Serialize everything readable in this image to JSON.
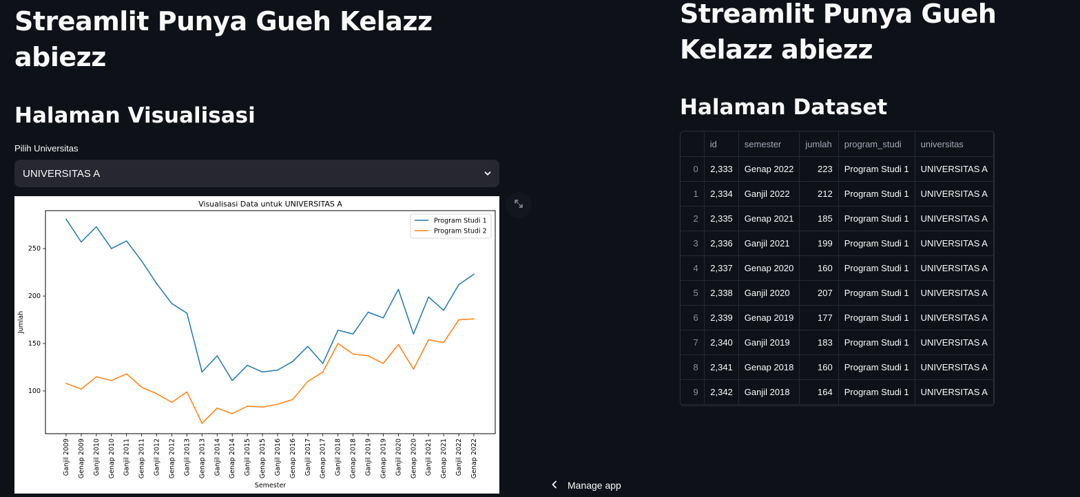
{
  "left": {
    "title": "Streamlit Punya Gueh Kelazz abiezz",
    "subtitle": "Halaman Visualisasi",
    "select_label": "Pilih Universitas",
    "select_value": "UNIVERSITAS A"
  },
  "right": {
    "title": "Streamlit Punya Gueh Kelazz abiezz",
    "subtitle": "Halaman Dataset"
  },
  "table": {
    "columns": [
      "",
      "id",
      "semester",
      "jumlah",
      "program_studi",
      "universitas"
    ],
    "rows": [
      [
        "0",
        "2,333",
        "Genap 2022",
        "223",
        "Program Studi 1",
        "UNIVERSITAS A"
      ],
      [
        "1",
        "2,334",
        "Ganjil 2022",
        "212",
        "Program Studi 1",
        "UNIVERSITAS A"
      ],
      [
        "2",
        "2,335",
        "Genap 2021",
        "185",
        "Program Studi 1",
        "UNIVERSITAS A"
      ],
      [
        "3",
        "2,336",
        "Ganjil 2021",
        "199",
        "Program Studi 1",
        "UNIVERSITAS A"
      ],
      [
        "4",
        "2,337",
        "Genap 2020",
        "160",
        "Program Studi 1",
        "UNIVERSITAS A"
      ],
      [
        "5",
        "2,338",
        "Ganjil 2020",
        "207",
        "Program Studi 1",
        "UNIVERSITAS A"
      ],
      [
        "6",
        "2,339",
        "Genap 2019",
        "177",
        "Program Studi 1",
        "UNIVERSITAS A"
      ],
      [
        "7",
        "2,340",
        "Ganjil 2019",
        "183",
        "Program Studi 1",
        "UNIVERSITAS A"
      ],
      [
        "8",
        "2,341",
        "Genap 2018",
        "160",
        "Program Studi 1",
        "UNIVERSITAS A"
      ],
      [
        "9",
        "2,342",
        "Ganjil 2018",
        "164",
        "Program Studi 1",
        "UNIVERSITAS A"
      ]
    ]
  },
  "manage_app": "Manage app",
  "icons": {
    "select_chevron": "chevron-down-icon",
    "fullscreen": "expand-icon",
    "manage": "chevron-left-icon"
  },
  "chart_data": {
    "type": "line",
    "title": "Visualisasi Data untuk UNIVERSITAS A",
    "xlabel": "Semester",
    "ylabel": "Jumlah",
    "ylim": [
      55,
      290
    ],
    "yticks": [
      100,
      150,
      200,
      250
    ],
    "legend_position": "top-right",
    "grid": false,
    "x": [
      "Ganjil 2009",
      "Genap 2009",
      "Ganjil 2010",
      "Genap 2010",
      "Ganjil 2011",
      "Genap 2011",
      "Ganjil 2012",
      "Genap 2012",
      "Ganjil 2013",
      "Genap 2013",
      "Ganjil 2014",
      "Genap 2014",
      "Ganjil 2015",
      "Genap 2015",
      "Ganjil 2016",
      "Genap 2016",
      "Ganjil 2017",
      "Genap 2017",
      "Ganjil 2018",
      "Genap 2018",
      "Ganjil 2019",
      "Genap 2019",
      "Ganjil 2020",
      "Genap 2020",
      "Ganjil 2021",
      "Genap 2021",
      "Ganjil 2022",
      "Genap 2022"
    ],
    "series": [
      {
        "name": "Program Studi 1",
        "color": "#1f77b4",
        "values": [
          281,
          257,
          273,
          250,
          258,
          237,
          213,
          192,
          182,
          120,
          137,
          111,
          127,
          120,
          122,
          131,
          147,
          129,
          164,
          160,
          183,
          177,
          207,
          160,
          199,
          185,
          212,
          223
        ]
      },
      {
        "name": "Program Studi 2",
        "color": "#ff7f0e",
        "values": [
          108,
          102,
          115,
          111,
          118,
          104,
          97,
          88,
          99,
          66,
          82,
          76,
          84,
          83,
          86,
          91,
          110,
          120,
          150,
          139,
          137,
          129,
          149,
          123,
          154,
          151,
          175,
          176
        ]
      }
    ]
  }
}
